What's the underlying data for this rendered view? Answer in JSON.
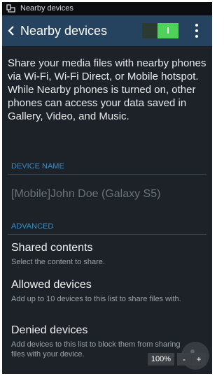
{
  "status_bar": {
    "notification_icon": "nearby-devices-icon",
    "text": "Nearby devices"
  },
  "action_bar": {
    "back_icon": "chevron-left-icon",
    "title": "Nearby devices",
    "toggle": {
      "state": "on",
      "label": "I"
    },
    "more_icon": "more-vertical-icon"
  },
  "description": "Share your media files with nearby phones via Wi-Fi, Wi-Fi Direct, or Mobile hotspot. While Nearby phones is turned on, other phones can access your data saved in Gallery, Video, and Music.",
  "device_name_section": {
    "header": "DEVICE NAME",
    "value": "[Mobile]John Doe (Galaxy S5)"
  },
  "advanced_section": {
    "header": "ADVANCED",
    "items": [
      {
        "title": "Shared contents",
        "subtitle": "Select the content to share."
      },
      {
        "title": "Allowed devices",
        "subtitle": "Add up to 10 devices to this list to share files with."
      },
      {
        "title": "Denied devices",
        "subtitle": "Add devices to this list to block them from sharing files with your device."
      }
    ]
  },
  "zoom": {
    "level": "100%",
    "minus": "-",
    "plus": "+"
  },
  "colors": {
    "background": "#1c2228",
    "action_bar": "#25435e",
    "accent": "#3f8cc2",
    "toggle_on": "#4fd25a"
  }
}
